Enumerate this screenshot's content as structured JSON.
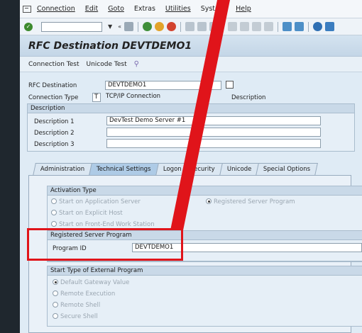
{
  "menu": {
    "items": [
      "Connection",
      "Edit",
      "Goto",
      "Extras",
      "Utilities",
      "System",
      "Help"
    ]
  },
  "title": "RFC Destination DEVTDEMO1",
  "app_toolbar": {
    "connection_test": "Connection Test",
    "unicode_test": "Unicode Test"
  },
  "header": {
    "rfc_destination_label": "RFC Destination",
    "rfc_destination_value": "DEVTDEMO1",
    "connection_type_label": "Connection Type",
    "connection_type_code": "T",
    "connection_type_value": "TCP/IP Connection",
    "description_link": "Description"
  },
  "description": {
    "header": "Description",
    "d1_label": "Description 1",
    "d1_value": "DevTest Demo Server #1",
    "d2_label": "Description 2",
    "d2_value": "",
    "d3_label": "Description 3",
    "d3_value": ""
  },
  "tabs": [
    "Administration",
    "Technical Settings",
    "Logon & Security",
    "Unicode",
    "Special Options"
  ],
  "activation": {
    "header": "Activation Type",
    "options": [
      "Start on Application Server",
      "Start on Explicit Host",
      "Start on Front-End Work Station"
    ],
    "registered": "Registered Server Program"
  },
  "registered_server": {
    "header": "Registered Server Program",
    "program_id_label": "Program ID",
    "program_id_value": "DEVTDEMO1"
  },
  "start_type": {
    "header": "Start Type of External Program",
    "options": [
      "Default Gateway Value",
      "Remote Execution",
      "Remote Shell",
      "Secure Shell"
    ]
  },
  "colors": {
    "highlight": "#e0141a",
    "window_bg": "#dfebf5",
    "title_bg": "#c4d6e7"
  }
}
